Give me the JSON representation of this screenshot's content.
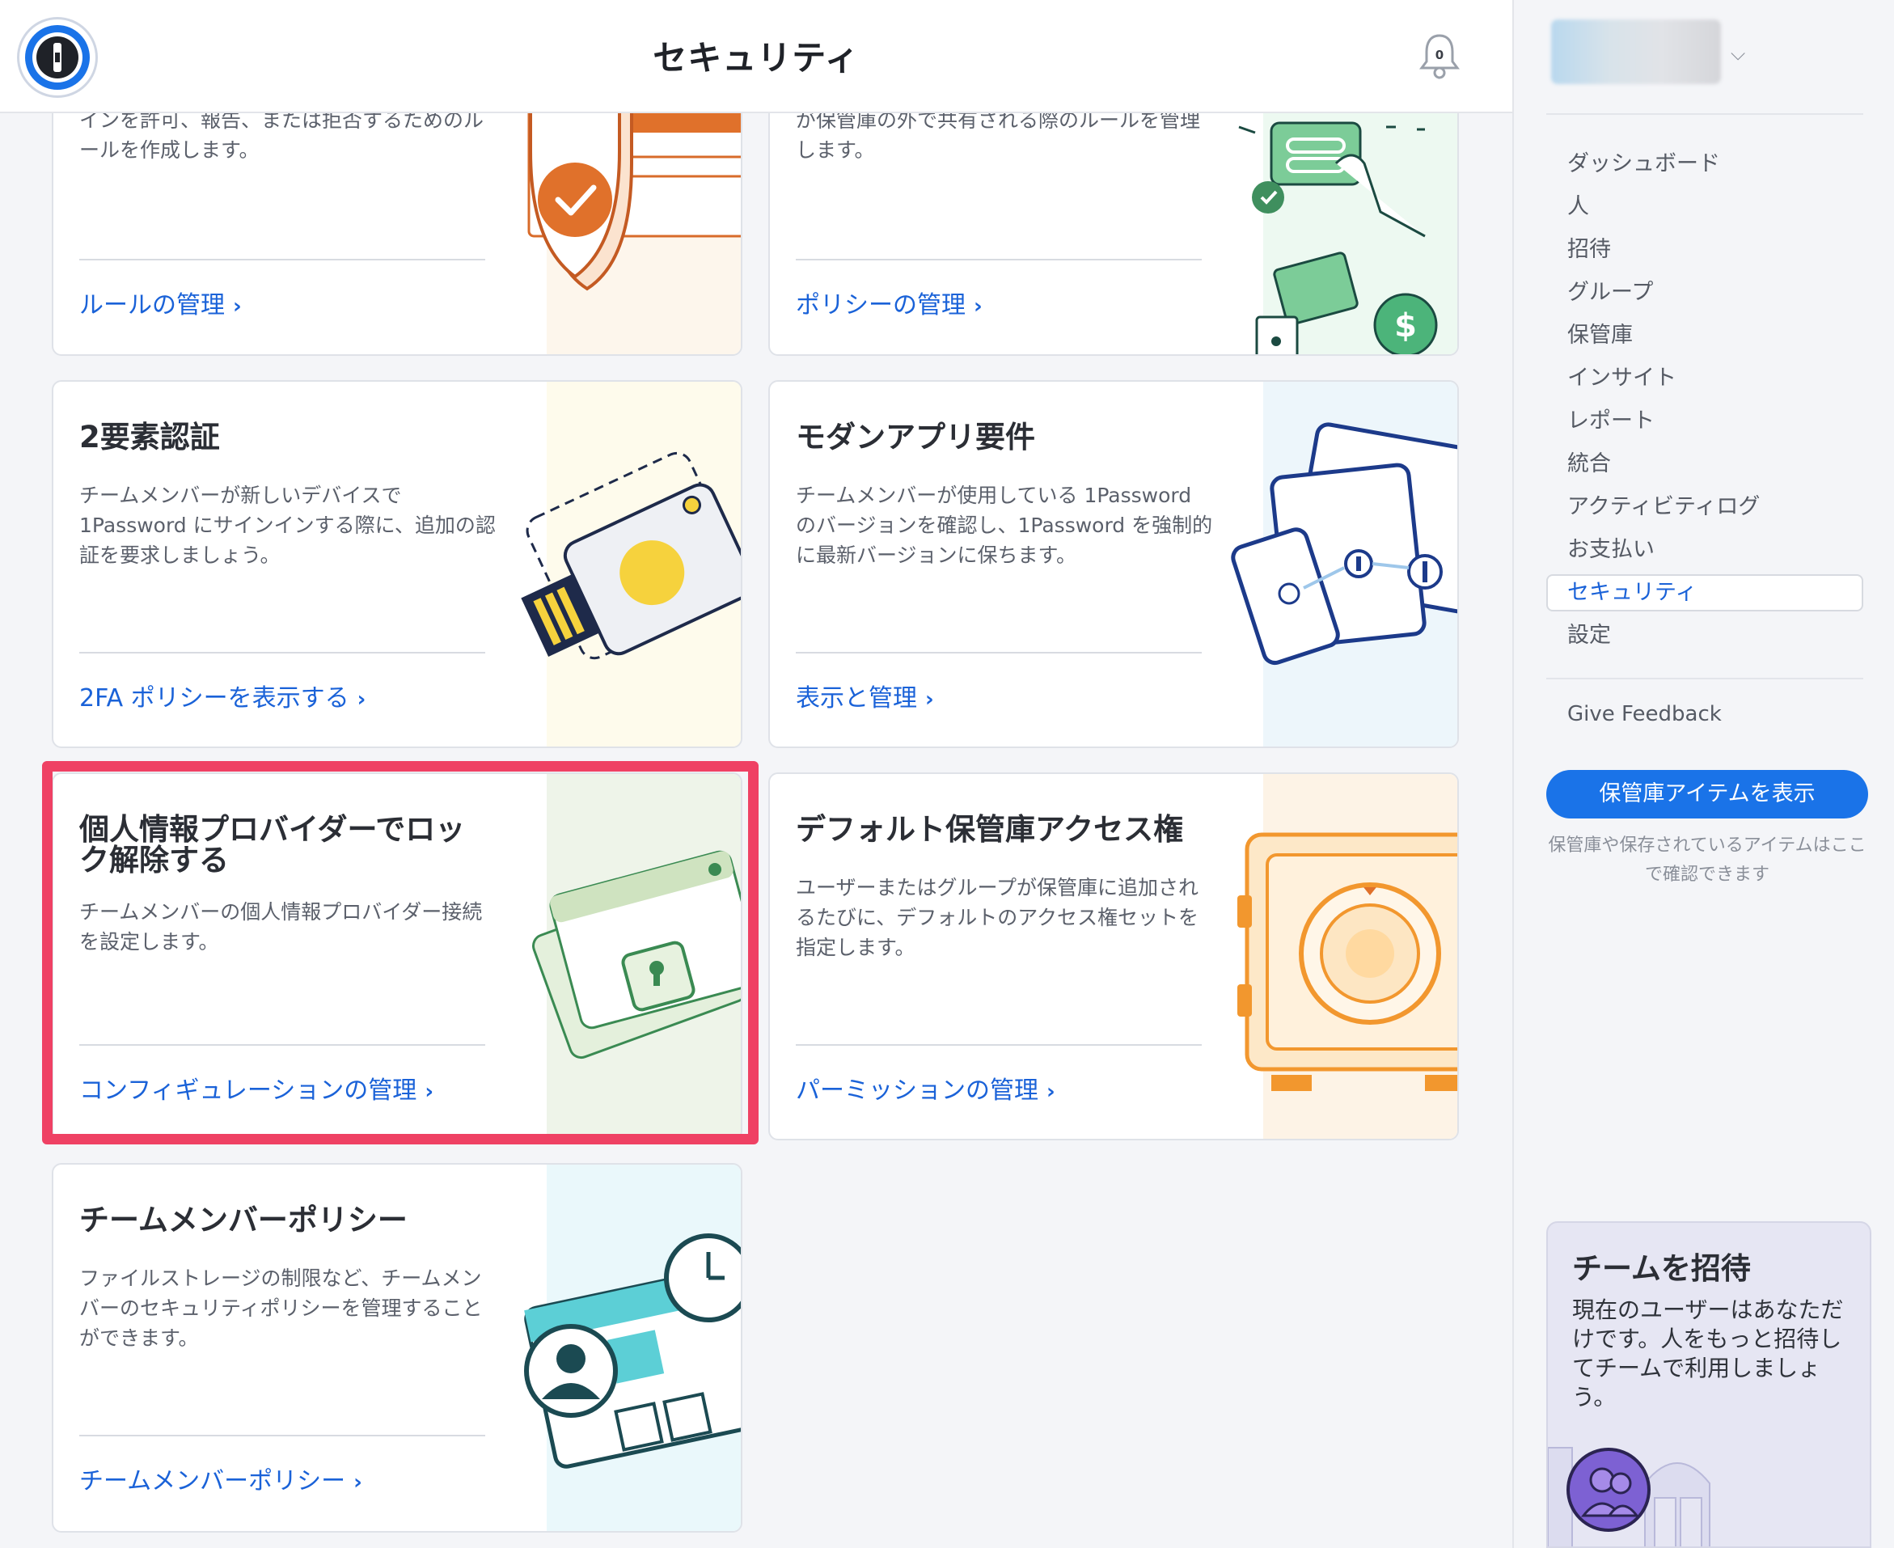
{
  "header": {
    "title": "セキュリティ",
    "notification_count": "0"
  },
  "cards": [
    {
      "id": "sign-in-rules",
      "title": "",
      "description": "インを許可、報告、または拒否するためのルールを作成します。",
      "link": "ルールの管理"
    },
    {
      "id": "sharing-policy",
      "title": "",
      "description": "が保管庫の外で共有される際のルールを管理します。",
      "link": "ポリシーの管理"
    },
    {
      "id": "two-factor",
      "title": "2要素認証",
      "description": "チームメンバーが新しいデバイスで1Password にサインインする際に、追加の認証を要求しましょう。",
      "link": "2FA ポリシーを表示する"
    },
    {
      "id": "modern-app",
      "title": "モダンアプリ要件",
      "description": "チームメンバーが使用している 1Password のバージョンを確認し、1Password を強制的に最新バージョンに保ちます。",
      "link": "表示と管理"
    },
    {
      "id": "identity-provider",
      "title": "個人情報プロバイダーでロック解除する",
      "description": "チームメンバーの個人情報プロバイダー接続を設定します。",
      "link": "コンフィギュレーションの管理"
    },
    {
      "id": "default-vault-access",
      "title": "デフォルト保管庫アクセス権",
      "description": "ユーザーまたはグループが保管庫に追加されるたびに、デフォルトのアクセス権セットを指定します。",
      "link": "パーミッションの管理"
    },
    {
      "id": "team-member-policy",
      "title": "チームメンバーポリシー",
      "description": "ファイルストレージの制限など、チームメンバーのセキュリティポリシーを管理することができます。",
      "link": "チームメンバーポリシー"
    }
  ],
  "sidebar": {
    "nav": [
      {
        "label": "ダッシュボード"
      },
      {
        "label": "人"
      },
      {
        "label": "招待"
      },
      {
        "label": "グループ"
      },
      {
        "label": "保管庫"
      },
      {
        "label": "インサイト"
      },
      {
        "label": "レポート"
      },
      {
        "label": "統合"
      },
      {
        "label": "アクティビティログ"
      },
      {
        "label": "お支払い"
      },
      {
        "label": "セキュリティ",
        "active": true
      },
      {
        "label": "設定"
      }
    ],
    "feedback": "Give Feedback",
    "vault_button": "保管庫アイテムを表示",
    "vault_note": "保管庫や保存されているアイテムはここで確認できます",
    "invite": {
      "title": "チームを招待",
      "description": "現在のユーザーはあなただけです。人をもっと招待してチームで利用しましょう。"
    }
  },
  "colors": {
    "accent": "#1a73e8",
    "link": "#1a62d8",
    "highlight": "#ef4164",
    "active_nav_text": "#1a62d8"
  },
  "icons": {
    "logo": "1password-logo-icon",
    "bell": "bell-icon",
    "chevron": "chevron-right-icon",
    "account_dropdown": "chevron-down-icon"
  }
}
